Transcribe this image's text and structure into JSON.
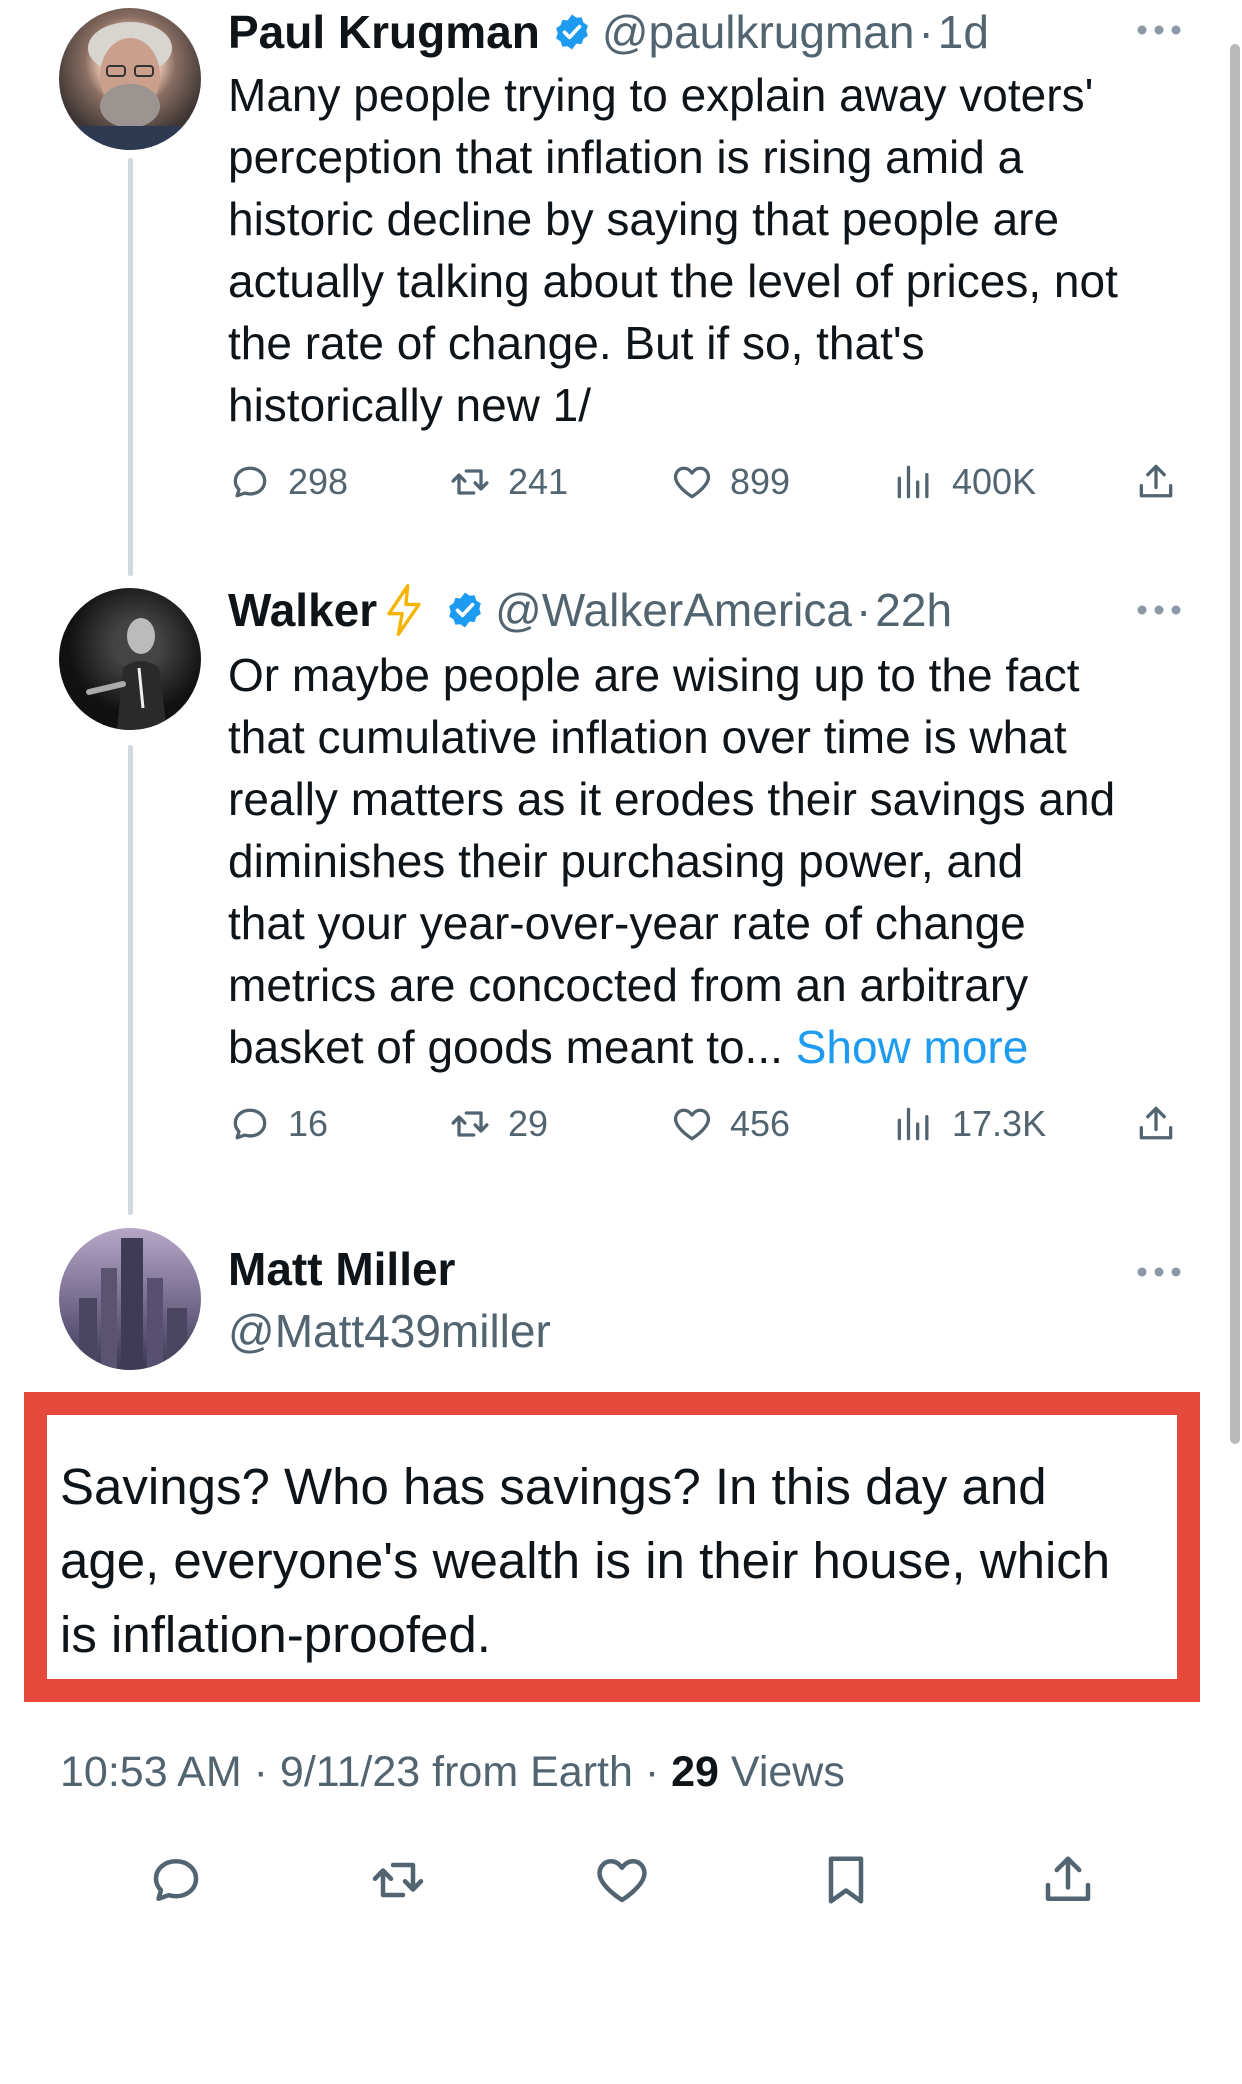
{
  "tweet1": {
    "name": "Paul Krugman",
    "handle": "@paulkrugman",
    "time": "1d",
    "text": "Many people trying to explain away voters'\nperception that inflation is rising amid a\nhistoric decline by saying that people are\nactually talking about the level of prices, not\nthe rate of change. But if so, that's\nhistorically new 1/",
    "replies": "298",
    "reposts": "241",
    "likes": "899",
    "views": "400K"
  },
  "tweet2": {
    "name": "Walker",
    "handle": "@WalkerAmerica",
    "time": "22h",
    "text": "Or maybe people are wising up to the fact\nthat cumulative inflation over time is what\nreally matters as it erodes their savings and\ndiminishes their purchasing power, and\nthat your year-over-year rate of change\nmetrics are concocted from an arbitrary\nbasket of goods meant to... ",
    "show_more": "Show more",
    "replies": "16",
    "reposts": "29",
    "likes": "456",
    "views": "17.3K"
  },
  "reply": {
    "name": "Matt Miller",
    "handle": "@Matt439miller",
    "text": "Savings? Who has savings? In this day and\nage, everyone's wealth is in their house, which\nis inflation-proofed.",
    "time": "10:53 AM",
    "date": "9/11/23",
    "source": "from Earth",
    "views_count": "29",
    "views_label": "Views"
  },
  "colors": {
    "verified": "#1d9bf0",
    "link": "#1d9bf0",
    "highlight_border": "#e4493b",
    "lightning": "#f4b400"
  },
  "icons": [
    "reply-icon",
    "repost-icon",
    "like-icon",
    "views-icon",
    "share-icon",
    "bookmark-icon",
    "verified-icon",
    "more-icon",
    "lightning-icon"
  ]
}
